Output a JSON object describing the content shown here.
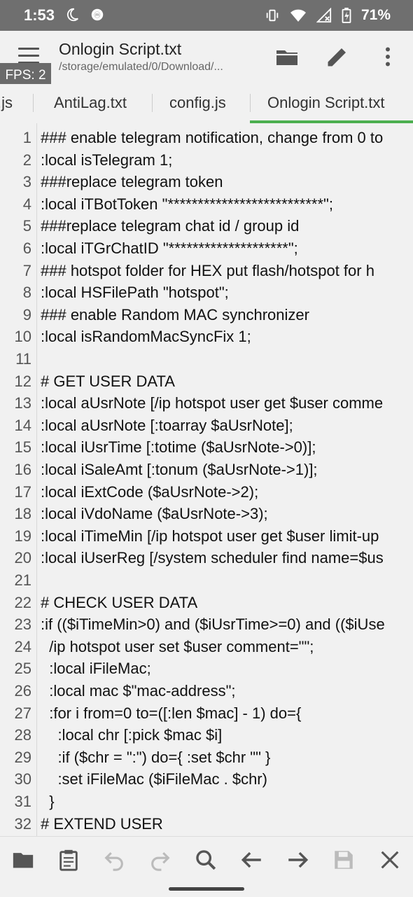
{
  "status": {
    "time": "1:53",
    "battery": "71%"
  },
  "appbar": {
    "title": "Onlogin Script.txt",
    "path": "/storage/emulated/0/Download/...",
    "fps": "FPS: 2",
    "icons": [
      "menu-icon",
      "folder-icon",
      "edit-icon",
      "more-vert-icon"
    ]
  },
  "tabs": [
    {
      "label": ".js"
    },
    {
      "label": "AntiLag.txt"
    },
    {
      "label": "config.js"
    },
    {
      "label": "Onlogin Script.txt",
      "active": true
    }
  ],
  "editor": {
    "lines": [
      {
        "n": "1",
        "t": "### enable telegram notification, change from 0 to"
      },
      {
        "n": "2",
        "t": ":local isTelegram 1;"
      },
      {
        "n": "3",
        "t": "###replace telegram token"
      },
      {
        "n": "4",
        "t": ":local iTBotToken \"**************************\";"
      },
      {
        "n": "5",
        "t": "###replace telegram chat id / group id"
      },
      {
        "n": "6",
        "t": ":local iTGrChatID \"********************\";"
      },
      {
        "n": "7",
        "t": "### hotspot folder for HEX put flash/hotspot for h"
      },
      {
        "n": "8",
        "t": ":local HSFilePath \"hotspot\";"
      },
      {
        "n": "9",
        "t": "### enable Random MAC synchronizer"
      },
      {
        "n": "10",
        "t": ":local isRandomMacSyncFix 1;"
      },
      {
        "n": "11",
        "t": ""
      },
      {
        "n": "12",
        "t": "# GET USER DATA"
      },
      {
        "n": "13",
        "t": ":local aUsrNote [/ip hotspot user get $user comme"
      },
      {
        "n": "14",
        "t": ":local aUsrNote [:toarray $aUsrNote];"
      },
      {
        "n": "15",
        "t": ":local iUsrTime [:totime ($aUsrNote->0)];"
      },
      {
        "n": "16",
        "t": ":local iSaleAmt [:tonum ($aUsrNote->1)];"
      },
      {
        "n": "17",
        "t": ":local iExtCode ($aUsrNote->2);"
      },
      {
        "n": "18",
        "t": ":local iVdoName ($aUsrNote->3);"
      },
      {
        "n": "19",
        "t": ":local iTimeMin [/ip hotspot user get $user limit-up"
      },
      {
        "n": "20",
        "t": ":local iUserReg [/system scheduler find name=$us"
      },
      {
        "n": "21",
        "t": ""
      },
      {
        "n": "22",
        "t": "# CHECK USER DATA"
      },
      {
        "n": "23",
        "t": ":if (($iTimeMin>0) and ($iUsrTime>=0) and (($iUse"
      },
      {
        "n": "24",
        "t": "  /ip hotspot user set $user comment=\"\";"
      },
      {
        "n": "25",
        "t": "  :local iFileMac;"
      },
      {
        "n": "26",
        "t": "  :local mac $\"mac-address\";"
      },
      {
        "n": "27",
        "t": "  :for i from=0 to=([:len $mac] - 1) do={"
      },
      {
        "n": "28",
        "t": "    :local chr [:pick $mac $i]"
      },
      {
        "n": "29",
        "t": "    :if ($chr = \":\") do={ :set $chr \"\" }"
      },
      {
        "n": "30",
        "t": "    :set iFileMac ($iFileMac . $chr)"
      },
      {
        "n": "31",
        "t": "  }"
      },
      {
        "n": "32",
        "t": "# EXTEND USER"
      }
    ]
  },
  "toolbar": {
    "icons": [
      "open-folder-icon",
      "clipboard-icon",
      "undo-icon",
      "redo-icon",
      "search-icon",
      "arrow-left-icon",
      "arrow-right-icon",
      "save-icon",
      "close-icon"
    ]
  }
}
